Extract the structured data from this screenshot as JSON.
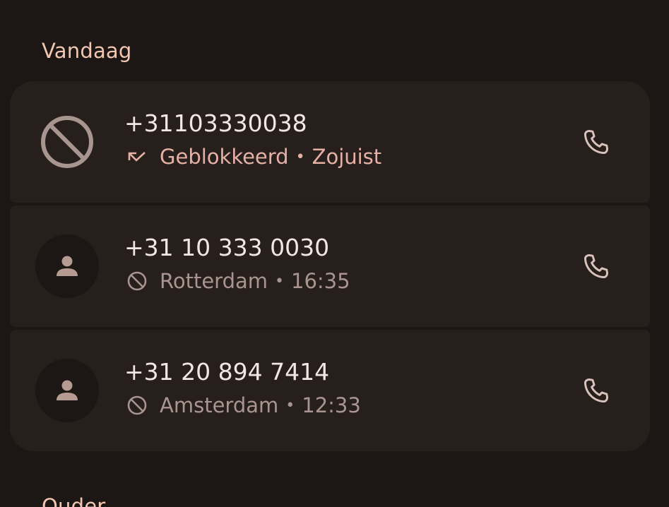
{
  "sections": {
    "today_label": "Vandaag",
    "older_label": "Ouder"
  },
  "calls": [
    {
      "number": "+31103330038",
      "status": "Geblokkeerd",
      "time": "Zojuist",
      "avatar_icon": "block-icon",
      "status_icon": "missed-call-icon"
    },
    {
      "number": "+31 10 333 0030",
      "location": "Rotterdam",
      "time": "16:35",
      "avatar_icon": "person-icon",
      "status_icon": "block-icon"
    },
    {
      "number": "+31 20 894 7414",
      "location": "Amsterdam",
      "time": "12:33",
      "avatar_icon": "person-icon",
      "status_icon": "block-icon"
    }
  ],
  "colors": {
    "background": "#1c1614",
    "card": "#261f1c",
    "accent": "#f1c7b2",
    "blocked_text": "#e6b0a6",
    "secondary_text": "#a99590"
  }
}
